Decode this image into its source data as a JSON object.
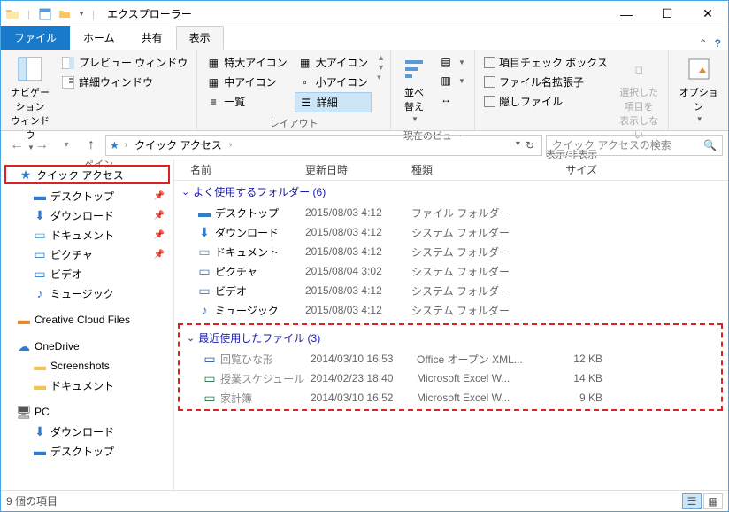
{
  "titlebar": {
    "title": "エクスプローラー"
  },
  "tabs": {
    "file": "ファイル",
    "home": "ホーム",
    "share": "共有",
    "view": "表示"
  },
  "ribbon": {
    "group1": {
      "nav_pane": "ナビゲーション\nウィンドウ",
      "preview": "プレビュー ウィンドウ",
      "details": "詳細ウィンドウ",
      "label": "ペイン"
    },
    "group2": {
      "xl_icons": "特大アイコン",
      "l_icons": "大アイコン",
      "m_icons": "中アイコン",
      "s_icons": "小アイコン",
      "list": "一覧",
      "details": "詳細",
      "label": "レイアウト"
    },
    "group3": {
      "sort": "並べ替え",
      "label": "現在のビュー"
    },
    "group4": {
      "item_check": "項目チェック ボックス",
      "file_ext": "ファイル名拡張子",
      "hidden": "隠しファイル",
      "hide_selected": "選択した項目を\n表示しない",
      "label": "表示/非表示"
    },
    "group5": {
      "options": "オプション"
    }
  },
  "address": {
    "breadcrumb": "クイック アクセス",
    "search_placeholder": "クイック アクセスの検索"
  },
  "nav": {
    "quick_access": "クイック アクセス",
    "desktop": "デスクトップ",
    "downloads": "ダウンロード",
    "documents": "ドキュメント",
    "pictures": "ピクチャ",
    "videos": "ビデオ",
    "music": "ミュージック",
    "creative_cloud": "Creative Cloud Files",
    "onedrive": "OneDrive",
    "screenshots": "Screenshots",
    "documents2": "ドキュメント",
    "pc": "PC",
    "downloads2": "ダウンロード",
    "desktop2": "デスクトップ"
  },
  "columns": {
    "name": "名前",
    "date": "更新日時",
    "type": "種類",
    "size": "サイズ"
  },
  "groups": {
    "frequent": "よく使用するフォルダー (6)",
    "recent": "最近使用したファイル (3)"
  },
  "frequent_items": [
    {
      "name": "デスクトップ",
      "date": "2015/08/03 4:12",
      "type": "ファイル フォルダー",
      "icon": "desktop"
    },
    {
      "name": "ダウンロード",
      "date": "2015/08/03 4:12",
      "type": "システム フォルダー",
      "icon": "downloads"
    },
    {
      "name": "ドキュメント",
      "date": "2015/08/03 4:12",
      "type": "システム フォルダー",
      "icon": "documents"
    },
    {
      "name": "ピクチャ",
      "date": "2015/08/04 3:02",
      "type": "システム フォルダー",
      "icon": "pictures"
    },
    {
      "name": "ビデオ",
      "date": "2015/08/03 4:12",
      "type": "システム フォルダー",
      "icon": "videos"
    },
    {
      "name": "ミュージック",
      "date": "2015/08/03 4:12",
      "type": "システム フォルダー",
      "icon": "music"
    }
  ],
  "recent_items": [
    {
      "name": "回覧ひな形",
      "date": "2014/03/10 16:53",
      "type": "Office オープン XML...",
      "size": "12 KB",
      "icon": "word"
    },
    {
      "name": "授業スケジュール",
      "date": "2014/02/23 18:40",
      "type": "Microsoft Excel W...",
      "size": "14 KB",
      "icon": "excel"
    },
    {
      "name": "家計簿",
      "date": "2014/03/10 16:52",
      "type": "Microsoft Excel W...",
      "size": "9 KB",
      "icon": "excel"
    }
  ],
  "statusbar": {
    "count": "9 個の項目"
  },
  "colors": {
    "desktop": "#2b7cd3",
    "downloads": "#2b7cd3",
    "documents": "#4a9edb",
    "pictures": "#2b7cd3",
    "videos": "#2b7cd3",
    "music": "#2b7cd3",
    "creative": "#e88b2e",
    "onedrive": "#2b7cd3",
    "pc": "#555",
    "word": "#2a5699",
    "excel": "#1f7244"
  }
}
